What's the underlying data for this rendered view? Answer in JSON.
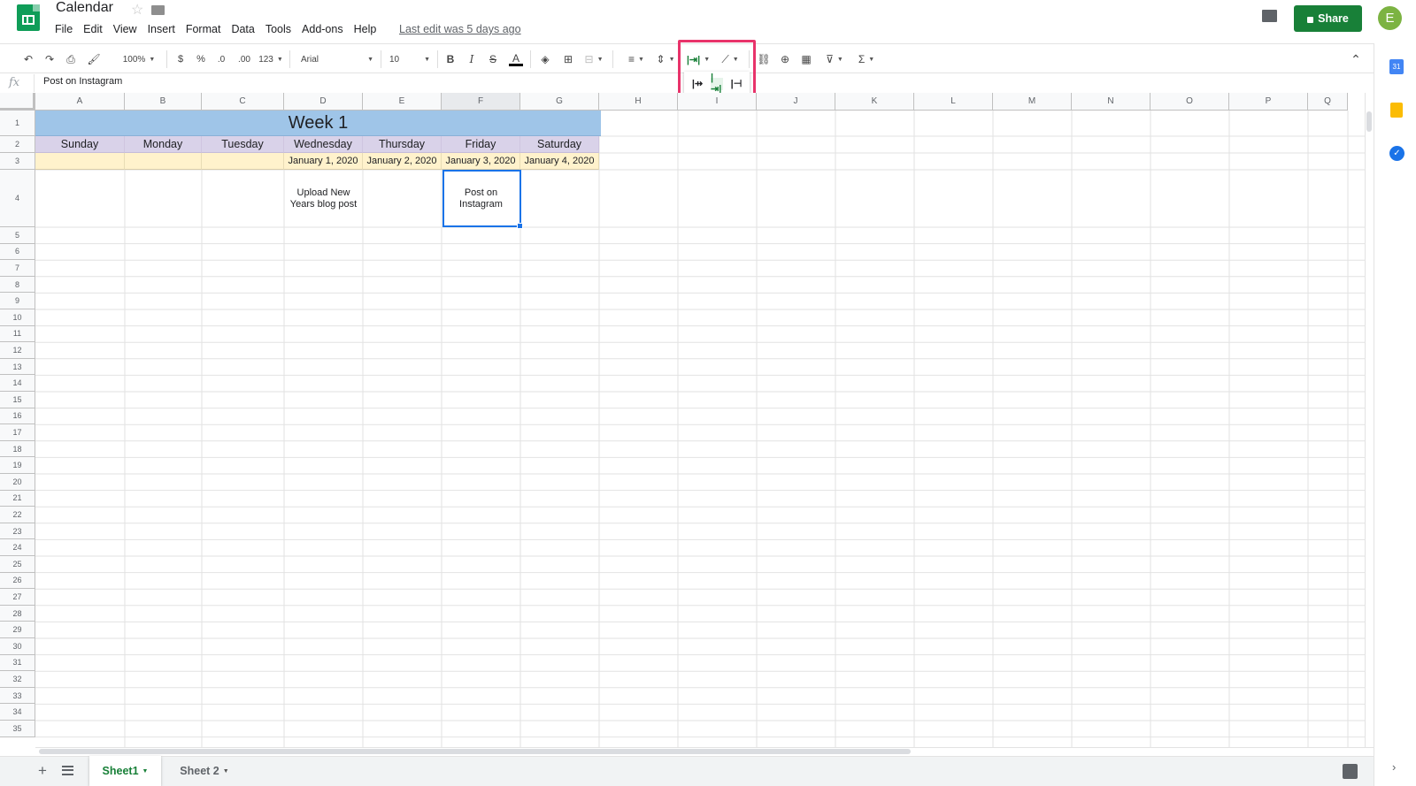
{
  "header": {
    "title": "Calendar",
    "menu": [
      "File",
      "Edit",
      "View",
      "Insert",
      "Format",
      "Data",
      "Tools",
      "Add-ons",
      "Help"
    ],
    "last_edit": "Last edit was 5 days ago",
    "share_label": "Share",
    "avatar_initial": "E"
  },
  "toolbar": {
    "zoom": "100%",
    "currency": "$",
    "percent": "%",
    "dec_decrease": ".0",
    "dec_increase": ".00",
    "more_formats": "123",
    "font": "Arial",
    "font_size": "10",
    "bold": "B",
    "italic": "I",
    "strike": "S",
    "text_color": "A",
    "sum": "Σ"
  },
  "formula_bar": {
    "fx": "fx",
    "value": "Post on Instagram"
  },
  "columns": [
    "A",
    "B",
    "C",
    "D",
    "E",
    "F",
    "G",
    "H",
    "I",
    "J",
    "K",
    "L",
    "M",
    "N",
    "O",
    "P",
    "Q"
  ],
  "rows": [
    "1",
    "2",
    "3",
    "4",
    "5",
    "6",
    "7",
    "8",
    "9",
    "10",
    "11",
    "12",
    "13",
    "14",
    "15",
    "16",
    "17",
    "18",
    "19",
    "20",
    "21",
    "22",
    "23",
    "24",
    "25",
    "26",
    "27",
    "28",
    "29",
    "30",
    "31",
    "32",
    "33",
    "34",
    "35"
  ],
  "sheet": {
    "week_title": "Week 1",
    "days": [
      "Sunday",
      "Monday",
      "Tuesday",
      "Wednesday",
      "Thursday",
      "Friday",
      "Saturday"
    ],
    "dates": [
      "",
      "",
      "",
      "January 1, 2020",
      "January 2, 2020",
      "January 3, 2020",
      "January 4, 2020"
    ],
    "notes": [
      "",
      "",
      "",
      "Upload New Years blog post",
      "",
      "Post on Instagram",
      ""
    ]
  },
  "tabs": {
    "sheets": [
      "Sheet1",
      "Sheet 2"
    ],
    "active": "Sheet1"
  },
  "side_panel": {
    "calendar_day": "31"
  },
  "colors": {
    "brand_green": "#188038",
    "week_header": "#9fc5e8",
    "day_header": "#d9d2e9",
    "date_row": "#fff2cc",
    "highlight": "#e8336a",
    "selection": "#1a73e8"
  }
}
